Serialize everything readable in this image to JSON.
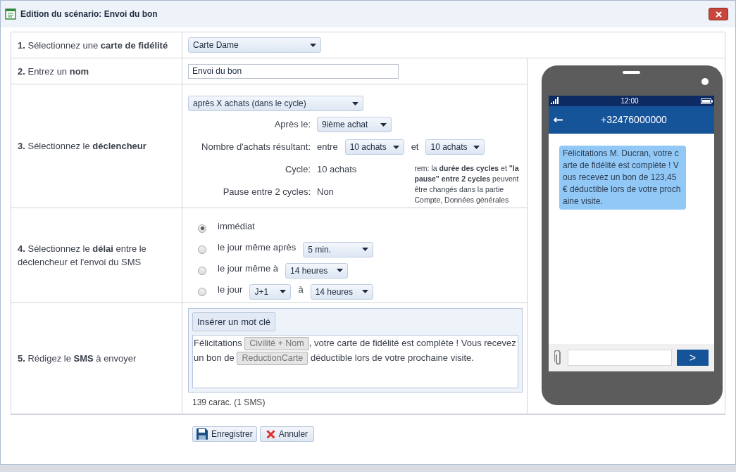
{
  "window": {
    "title": "Edition du scénario: Envoi du bon"
  },
  "steps": [
    {
      "label": "**1.** Sélectionnez une **carte de fidélité**",
      "kind": "card",
      "select": "Carte Dame"
    },
    {
      "label": "**2.** Entrez un **nom**",
      "kind": "name",
      "value": "Envoi du bon"
    },
    {
      "label": "**3.** Sélectionnez le **déclencheur**",
      "kind": "trigger",
      "select": "après X achats (dans le cycle)",
      "fields": [
        {
          "label": "Après le:",
          "parts": [
            {
              "kind": "select",
              "text": "9ième achat"
            }
          ]
        },
        {
          "label": "Nombre d'achats résultant:",
          "parts": [
            {
              "kind": "text",
              "text": "entre"
            },
            {
              "kind": "select",
              "text": "10 achats"
            },
            {
              "kind": "text",
              "text": "et"
            },
            {
              "kind": "select",
              "text": "10 achats"
            }
          ]
        },
        {
          "label": "Cycle:",
          "parts": [
            {
              "kind": "text",
              "text": "10 achats"
            }
          ]
        },
        {
          "label": "Pause entre 2 cycles:",
          "parts": [
            {
              "kind": "text",
              "text": "Non"
            }
          ]
        }
      ],
      "note": "rem: la **durée des cycles** et **\"la pause\" entre 2 cycles** peuvent être changés dans la partie Compte, Données générales"
    },
    {
      "label": "**4.** Sélectionnez le **délai** entre le déclencheur et l'envoi du SMS",
      "kind": "delay",
      "options": [
        {
          "selected": true,
          "parts": [
            {
              "kind": "text",
              "text": "immédiat"
            }
          ]
        },
        {
          "selected": false,
          "parts": [
            {
              "kind": "text",
              "text": "le jour même après"
            },
            {
              "kind": "select",
              "text": "5 min."
            }
          ]
        },
        {
          "selected": false,
          "parts": [
            {
              "kind": "text",
              "text": "le jour même à"
            },
            {
              "kind": "select",
              "text": "14 heures"
            }
          ]
        },
        {
          "selected": false,
          "parts": [
            {
              "kind": "text",
              "text": "le jour"
            },
            {
              "kind": "select",
              "text": "J+1"
            },
            {
              "kind": "text",
              "text": "à"
            },
            {
              "kind": "select",
              "text": "14 heures"
            }
          ]
        }
      ]
    },
    {
      "label": "**5.** Rédigez le **SMS** à envoyer",
      "kind": "sms",
      "insert_button": "Insérer un mot clé",
      "message": [
        {
          "kind": "text",
          "text": "Félicitations "
        },
        {
          "kind": "keyword",
          "text": "Civilité + Nom"
        },
        {
          "kind": "text",
          "text": ", votre carte de fidélité est complète ! Vous recevez un bon de "
        },
        {
          "kind": "keyword",
          "text": "ReductionCarte"
        },
        {
          "kind": "text",
          "text": " déductible lors de votre prochaine visite."
        }
      ],
      "count": "139 carac. (1 SMS)"
    }
  ],
  "phone": {
    "time": "12:00",
    "contact": "+32476000000",
    "message": "Félicitations M. Ducran, votre carte de fidélité est complète ! Vous recevez un bon de 123,45 € déductible lors de votre prochaine visite.",
    "send": ">"
  },
  "buttons": [
    {
      "kind": "save",
      "label": "Enregistrer"
    },
    {
      "kind": "cancel",
      "label": "Annuler"
    }
  ]
}
